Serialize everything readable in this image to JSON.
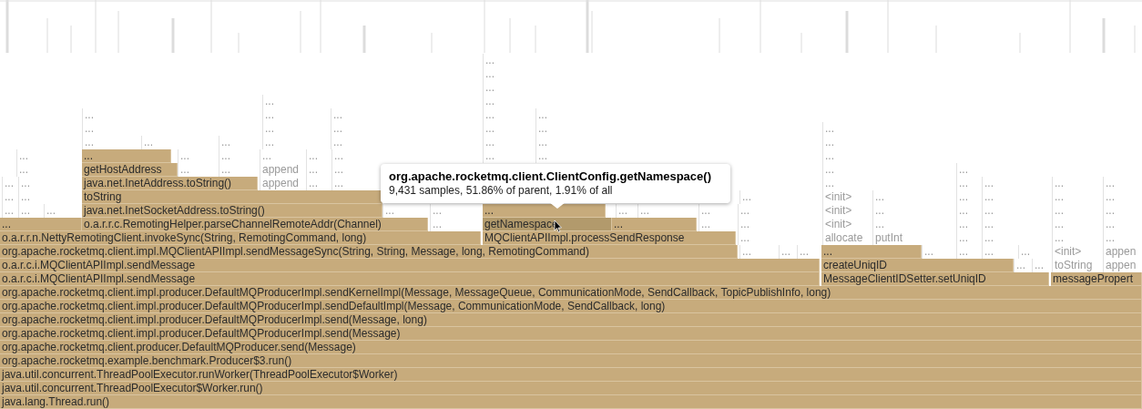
{
  "flame_graph": {
    "rows": [
      {
        "frames": [
          {
            "label": "...",
            "kind": "cold"
          }
        ]
      },
      {
        "frames": [
          {
            "label": "...",
            "kind": "cold"
          }
        ]
      },
      {
        "frames": [
          {
            "label": "...",
            "kind": "cold"
          }
        ]
      },
      {
        "frames": [
          {
            "label": "...",
            "kind": "cold"
          },
          {
            "label": "...",
            "kind": "cold"
          }
        ]
      },
      {
        "frames": [
          {
            "label": "...",
            "kind": "cold"
          },
          {
            "label": "...",
            "kind": "cold"
          },
          {
            "label": "...",
            "kind": "cold"
          },
          {
            "label": "...",
            "kind": "cold"
          },
          {
            "label": "...",
            "kind": "cold"
          }
        ]
      },
      {
        "frames": [
          {
            "label": "...",
            "kind": "cold"
          },
          {
            "label": "...",
            "kind": "cold"
          },
          {
            "label": "...",
            "kind": "cold"
          },
          {
            "label": "...",
            "kind": "cold"
          },
          {
            "label": "...",
            "kind": "cold"
          },
          {
            "label": "...",
            "kind": "cold"
          }
        ]
      },
      {
        "frames": [
          {
            "label": "...",
            "kind": "cold"
          },
          {
            "label": "...",
            "kind": "cold"
          },
          {
            "label": "...",
            "kind": "cold"
          },
          {
            "label": "...",
            "kind": "cold"
          },
          {
            "label": "...",
            "kind": "cold"
          },
          {
            "label": "...",
            "kind": "cold"
          },
          {
            "label": "...",
            "kind": "cold"
          },
          {
            "label": "...",
            "kind": "cold"
          }
        ]
      },
      {
        "frames": [
          {
            "label": "...",
            "kind": "cold"
          },
          {
            "label": "...",
            "kind": "hot"
          },
          {
            "label": "...",
            "kind": "cold"
          },
          {
            "label": "...",
            "kind": "cold"
          },
          {
            "label": "...",
            "kind": "cold"
          },
          {
            "label": "...",
            "kind": "cold"
          },
          {
            "label": "...",
            "kind": "cold"
          },
          {
            "label": "...",
            "kind": "cold"
          },
          {
            "label": "...",
            "kind": "cold"
          },
          {
            "label": "...",
            "kind": "cold"
          }
        ]
      },
      {
        "frames": [
          {
            "label": "...",
            "kind": "cold"
          },
          {
            "label": "getHostAddress",
            "kind": "hot"
          },
          {
            "label": "...",
            "kind": "cold"
          },
          {
            "label": "...",
            "kind": "cold"
          },
          {
            "label": "append",
            "kind": "cold"
          },
          {
            "label": "...",
            "kind": "cold"
          },
          {
            "label": "...",
            "kind": "cold"
          },
          {
            "label": "...",
            "kind": "cold"
          },
          {
            "label": "...",
            "kind": "cold"
          }
        ]
      },
      {
        "frames": [
          {
            "label": "...",
            "kind": "cold"
          },
          {
            "label": "...",
            "kind": "cold"
          },
          {
            "label": "java.net.InetAddress.toString()",
            "kind": "hot"
          },
          {
            "label": "append",
            "kind": "cold"
          },
          {
            "label": "...",
            "kind": "cold"
          },
          {
            "label": "...",
            "kind": "cold"
          },
          {
            "label": "...",
            "kind": "cold"
          },
          {
            "label": "...",
            "kind": "cold"
          },
          {
            "label": "...",
            "kind": "cold"
          },
          {
            "label": "...",
            "kind": "cold"
          },
          {
            "label": "...",
            "kind": "cold"
          }
        ]
      },
      {
        "frames": [
          {
            "label": "...",
            "kind": "cold"
          },
          {
            "label": "...",
            "kind": "cold"
          },
          {
            "label": "toString",
            "kind": "hot"
          },
          {
            "label": "...",
            "kind": "cold"
          },
          {
            "label": "<init>",
            "kind": "cold"
          },
          {
            "label": "...",
            "kind": "cold"
          },
          {
            "label": "...",
            "kind": "cold"
          },
          {
            "label": "...",
            "kind": "cold"
          },
          {
            "label": "...",
            "kind": "cold"
          },
          {
            "label": "...",
            "kind": "cold"
          }
        ]
      },
      {
        "frames": [
          {
            "label": "...",
            "kind": "cold"
          },
          {
            "label": "...",
            "kind": "cold"
          },
          {
            "label": "...",
            "kind": "cold"
          },
          {
            "label": "java.net.InetSocketAddress.toString()",
            "kind": "hot"
          },
          {
            "label": "...",
            "kind": "cold"
          },
          {
            "label": "...",
            "kind": "cold"
          },
          {
            "label": "...",
            "kind": "hot"
          },
          {
            "label": "...",
            "kind": "cold"
          },
          {
            "label": "...",
            "kind": "cold"
          },
          {
            "label": "...",
            "kind": "cold"
          },
          {
            "label": "...",
            "kind": "cold"
          },
          {
            "label": "<init>",
            "kind": "cold"
          },
          {
            "label": "...",
            "kind": "cold"
          },
          {
            "label": "...",
            "kind": "cold"
          },
          {
            "label": "...",
            "kind": "cold"
          },
          {
            "label": "...",
            "kind": "cold"
          },
          {
            "label": "...",
            "kind": "cold"
          }
        ]
      },
      {
        "frames": [
          {
            "label": "...",
            "kind": "hot"
          },
          {
            "label": "o.a.r.r.c.RemotingHelper.parseChannelRemoteAddr(Channel)",
            "kind": "hot"
          },
          {
            "label": "...",
            "kind": "cold"
          },
          {
            "label": "getNamespace",
            "kind": "hover"
          },
          {
            "label": "...",
            "kind": "hot"
          },
          {
            "label": "...",
            "kind": "cold"
          },
          {
            "label": "...",
            "kind": "cold"
          },
          {
            "label": "<init>",
            "kind": "cold"
          },
          {
            "label": "...",
            "kind": "cold"
          },
          {
            "label": "...",
            "kind": "cold"
          },
          {
            "label": "...",
            "kind": "cold"
          },
          {
            "label": "...",
            "kind": "cold"
          },
          {
            "label": "...",
            "kind": "cold"
          }
        ]
      },
      {
        "frames": [
          {
            "label": "o.a.r.r.n.NettyRemotingClient.invokeSync(String, RemotingCommand, long)",
            "kind": "hot"
          },
          {
            "label": "MQClientAPIImpl.processSendResponse",
            "kind": "hot"
          },
          {
            "label": "...",
            "kind": "cold"
          },
          {
            "label": "allocate",
            "kind": "cold"
          },
          {
            "label": "putInt",
            "kind": "cold"
          },
          {
            "label": "...",
            "kind": "cold"
          },
          {
            "label": "...",
            "kind": "cold"
          },
          {
            "label": "...",
            "kind": "cold"
          },
          {
            "label": "...",
            "kind": "cold"
          }
        ]
      },
      {
        "frames": [
          {
            "label": "org.apache.rocketmq.client.impl.MQClientAPIImpl.sendMessageSync(String, String, Message, long, RemotingCommand)",
            "kind": "hot"
          },
          {
            "label": "...",
            "kind": "cold"
          },
          {
            "label": "...",
            "kind": "cold"
          },
          {
            "label": "...",
            "kind": "cold"
          },
          {
            "label": "...",
            "kind": "hot"
          },
          {
            "label": "...",
            "kind": "cold"
          },
          {
            "label": "...",
            "kind": "cold"
          },
          {
            "label": "...",
            "kind": "cold"
          },
          {
            "label": "...",
            "kind": "cold"
          },
          {
            "label": "<init>",
            "kind": "cold"
          },
          {
            "label": "appen",
            "kind": "cold"
          }
        ]
      },
      {
        "frames": [
          {
            "label": "o.a.r.c.i.MQClientAPIImpl.sendMessage",
            "kind": "hot"
          },
          {
            "label": "createUniqID",
            "kind": "hot"
          },
          {
            "label": "...",
            "kind": "cold"
          },
          {
            "label": "...",
            "kind": "cold"
          },
          {
            "label": "toString",
            "kind": "cold"
          },
          {
            "label": "appen",
            "kind": "cold"
          }
        ]
      },
      {
        "frames": [
          {
            "label": "o.a.r.c.i.MQClientAPIImpl.sendMessage",
            "kind": "hot"
          },
          {
            "label": "MessageClientIDSetter.setUniqID",
            "kind": "hot"
          },
          {
            "label": "messagePropert",
            "kind": "hot"
          }
        ]
      },
      {
        "frames": [
          {
            "label": "org.apache.rocketmq.client.impl.producer.DefaultMQProducerImpl.sendKernelImpl(Message, MessageQueue, CommunicationMode, SendCallback, TopicPublishInfo, long)",
            "kind": "hot"
          }
        ]
      },
      {
        "frames": [
          {
            "label": "org.apache.rocketmq.client.impl.producer.DefaultMQProducerImpl.sendDefaultImpl(Message, CommunicationMode, SendCallback, long)",
            "kind": "hot"
          }
        ]
      },
      {
        "frames": [
          {
            "label": "org.apache.rocketmq.client.impl.producer.DefaultMQProducerImpl.send(Message, long)",
            "kind": "hot"
          }
        ]
      },
      {
        "frames": [
          {
            "label": "org.apache.rocketmq.client.impl.producer.DefaultMQProducerImpl.send(Message)",
            "kind": "hot"
          }
        ]
      },
      {
        "frames": [
          {
            "label": "org.apache.rocketmq.client.producer.DefaultMQProducer.send(Message)",
            "kind": "hot"
          }
        ]
      },
      {
        "frames": [
          {
            "label": "org.apache.rocketmq.example.benchmark.Producer$3.run()",
            "kind": "hot"
          }
        ]
      },
      {
        "frames": [
          {
            "label": "java.util.concurrent.ThreadPoolExecutor.runWorker(ThreadPoolExecutor$Worker)",
            "kind": "hot"
          }
        ]
      },
      {
        "frames": [
          {
            "label": "java.util.concurrent.ThreadPoolExecutor$Worker.run()",
            "kind": "hot"
          }
        ]
      },
      {
        "frames": [
          {
            "label": "java.lang.Thread.run()",
            "kind": "hot"
          }
        ]
      }
    ]
  },
  "tooltip": {
    "title": "org.apache.rocketmq.client.ClientConfig.getNamespace()",
    "text": "9,431 samples, 51.86% of parent, 1.91% of all"
  }
}
